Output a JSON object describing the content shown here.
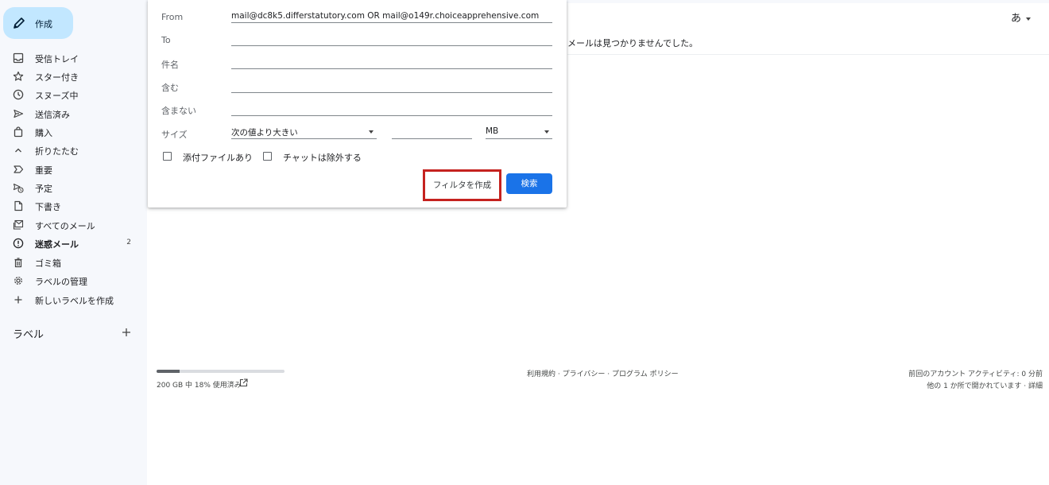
{
  "sidebar": {
    "compose_label": "作成",
    "items": [
      {
        "label": "受信トレイ",
        "icon": "inbox-icon"
      },
      {
        "label": "スター付き",
        "icon": "star-icon"
      },
      {
        "label": "スヌーズ中",
        "icon": "clock-icon"
      },
      {
        "label": "送信済み",
        "icon": "send-icon"
      },
      {
        "label": "購入",
        "icon": "shopping-bag-icon"
      },
      {
        "label": "折りたたむ",
        "icon": "chevron-up-icon"
      },
      {
        "label": "重要",
        "icon": "important-icon"
      },
      {
        "label": "予定",
        "icon": "scheduled-icon"
      },
      {
        "label": "下書き",
        "icon": "draft-icon"
      },
      {
        "label": "すべてのメール",
        "icon": "all-mail-icon"
      },
      {
        "label": "迷惑メール",
        "icon": "spam-icon",
        "count": "2",
        "bold": true
      },
      {
        "label": "ゴミ箱",
        "icon": "trash-icon"
      },
      {
        "label": "ラベルの管理",
        "icon": "gear-icon"
      },
      {
        "label": "新しいラベルを作成",
        "icon": "plus-icon"
      }
    ],
    "labels_heading": "ラベル"
  },
  "header": {
    "input_tools": "あ"
  },
  "main": {
    "no_results": "メールは見つかりませんでした。"
  },
  "search_panel": {
    "from_label": "From",
    "from_value": "mail@dc8k5.differstatutory.com OR mail@o149r.choiceapprehensive.com",
    "to_label": "To",
    "to_value": "",
    "subject_label": "件名",
    "subject_value": "",
    "has_words_label": "含む",
    "has_words_value": "",
    "not_words_label": "含まない",
    "not_words_value": "",
    "size_label": "サイズ",
    "size_operator": "次の値より大きい",
    "size_value": "",
    "size_unit": "MB",
    "has_attachment_label": "添付ファイルあり",
    "has_attachment_checked": false,
    "exclude_chats_label": "チャットは除外する",
    "exclude_chats_checked": false,
    "create_filter_label": "フィルタを作成",
    "search_label": "検索"
  },
  "footer": {
    "storage_used_fraction": 0.18,
    "storage_text": "200 GB 中 18% 使用済み",
    "terms": "利用規約",
    "sep1": " · ",
    "privacy": "プライバシー",
    "sep2": " · ",
    "program_policy": "プログラム ポリシー",
    "activity_line1": "前回のアカウント アクティビティ: 0 分前",
    "activity_line2": "他の 1 か所で開かれています · ",
    "details_link": "詳細"
  },
  "colors": {
    "compose_bg": "#c2e7ff",
    "primary_button": "#1a73e8",
    "highlight_box": "#c5221f",
    "sidebar_bg": "#f6f8fc"
  }
}
